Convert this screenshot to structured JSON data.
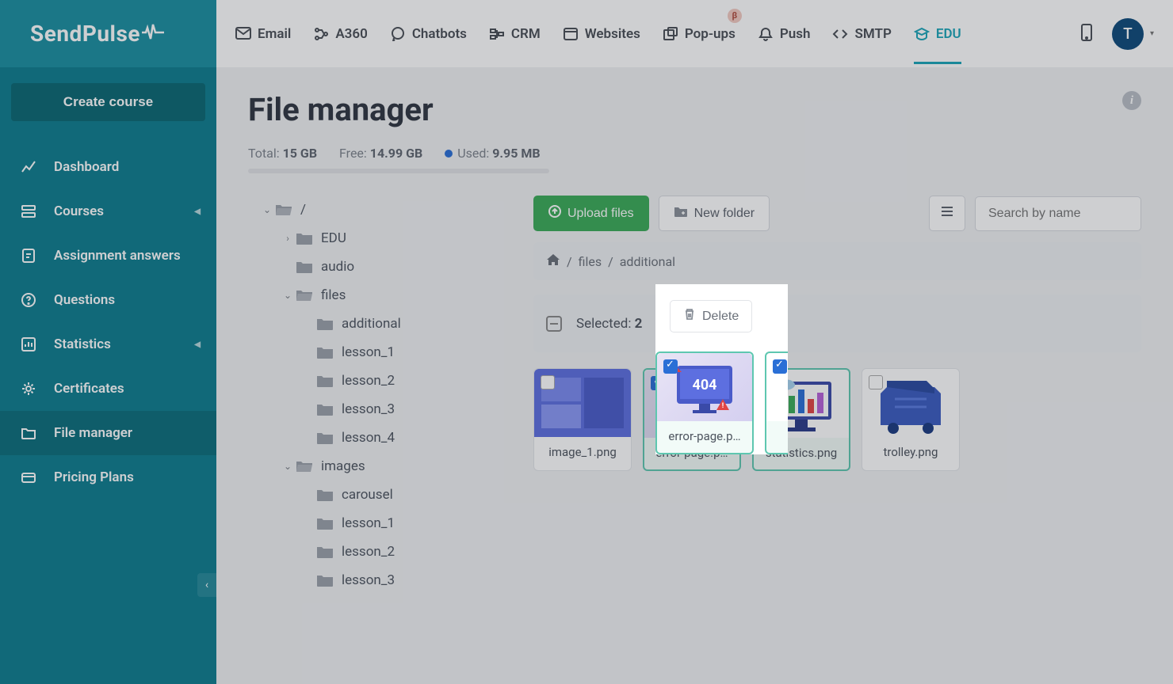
{
  "brand": "SendPulse",
  "sidebar": {
    "create_button": "Create course",
    "items": [
      {
        "label": "Dashboard"
      },
      {
        "label": "Courses",
        "chev": true
      },
      {
        "label": "Assignment answers"
      },
      {
        "label": "Questions"
      },
      {
        "label": "Statistics",
        "chev": true
      },
      {
        "label": "Certificates"
      },
      {
        "label": "File manager",
        "active": true
      },
      {
        "label": "Pricing Plans"
      }
    ]
  },
  "topnav": {
    "items": [
      {
        "label": "Email"
      },
      {
        "label": "A360"
      },
      {
        "label": "Chatbots"
      },
      {
        "label": "CRM"
      },
      {
        "label": "Websites"
      },
      {
        "label": "Pop-ups",
        "badge": "β"
      },
      {
        "label": "Push"
      },
      {
        "label": "SMTP"
      },
      {
        "label": "EDU",
        "active": true
      }
    ],
    "avatar_initial": "T"
  },
  "page": {
    "title": "File manager",
    "storage": {
      "total_label": "Total:",
      "total": "15 GB",
      "free_label": "Free:",
      "free": "14.99 GB",
      "used_label": "Used:",
      "used": "9.95 MB"
    },
    "tree": [
      {
        "label": "/",
        "level": 1,
        "caret": "down",
        "open": true
      },
      {
        "label": "EDU",
        "level": 2,
        "caret": "right"
      },
      {
        "label": "audio",
        "level": 2,
        "caret": "none"
      },
      {
        "label": "files",
        "level": 2,
        "caret": "down",
        "open": true
      },
      {
        "label": "additional",
        "level": 3,
        "caret": "none"
      },
      {
        "label": "lesson_1",
        "level": 3,
        "caret": "none"
      },
      {
        "label": "lesson_2",
        "level": 3,
        "caret": "none"
      },
      {
        "label": "lesson_3",
        "level": 3,
        "caret": "none"
      },
      {
        "label": "lesson_4",
        "level": 3,
        "caret": "none"
      },
      {
        "label": "images",
        "level": 2,
        "caret": "down",
        "open": true
      },
      {
        "label": "carousel",
        "level": 3,
        "caret": "none"
      },
      {
        "label": "lesson_1",
        "level": 3,
        "caret": "none"
      },
      {
        "label": "lesson_2",
        "level": 3,
        "caret": "none"
      },
      {
        "label": "lesson_3",
        "level": 3,
        "caret": "none"
      }
    ],
    "toolbar": {
      "upload": "Upload files",
      "new_folder": "New folder",
      "search_placeholder": "Search by name"
    },
    "breadcrumb": [
      "files",
      "additional"
    ],
    "selection": {
      "label": "Selected:",
      "count": "2",
      "delete": "Delete"
    },
    "files": [
      {
        "name": "image_1.png",
        "selected": false
      },
      {
        "name": "error-page.p…",
        "selected": true
      },
      {
        "name": "statistics.png",
        "selected": true
      },
      {
        "name": "trolley.png",
        "selected": false
      }
    ]
  }
}
